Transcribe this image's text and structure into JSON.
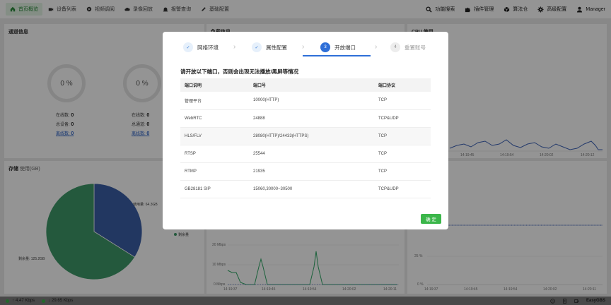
{
  "nav": [
    {
      "label": "首页概览",
      "icon": "home-icon",
      "active": true
    },
    {
      "label": "设备列表",
      "icon": "video-camera-icon"
    },
    {
      "label": "视频调阅",
      "icon": "play-circle-icon"
    },
    {
      "label": "录像回放",
      "icon": "cloud-icon"
    },
    {
      "label": "报警查询",
      "icon": "alarm-icon"
    },
    {
      "label": "基础配置",
      "icon": "pencil-icon"
    }
  ],
  "tools": [
    {
      "label": "功能搜索",
      "icon": "search-icon"
    },
    {
      "label": "插件管理",
      "icon": "puzzle-icon"
    },
    {
      "label": "算法仓",
      "icon": "cube-icon"
    },
    {
      "label": "高级配置",
      "icon": "gear-icon"
    },
    {
      "label": "Manager",
      "icon": "user-icon"
    }
  ],
  "panels": {
    "channel": {
      "title": "通道信息",
      "gauges": [
        {
          "value": "0 %",
          "online_label": "在线数:",
          "online": "0",
          "total_label": "总设备:",
          "total": "0",
          "offline_label": "离线数:",
          "offline": "0"
        },
        {
          "value": "0 %",
          "online_label": "在线数:",
          "online": "0",
          "total_label": "总通道:",
          "total": "0",
          "offline_label": "离线数:",
          "offline": "0"
        }
      ]
    },
    "load": {
      "title": "负载信息"
    },
    "cpu": {
      "title": "CPU 使用",
      "x_ticks": [
        "14:19:45",
        "14:19:54",
        "14:20:02",
        "14:20:12"
      ]
    },
    "storage": {
      "title": "存储",
      "title_sub": "使用(GB)",
      "used_label": "使用量: 64.3GB",
      "free_label": "剩余量: 125.2GB",
      "legend_free": "剩余量"
    },
    "network": {
      "y_ticks": [
        "20 Mbps",
        "10 Mbps",
        "0 Mbps"
      ],
      "x_ticks": [
        "14:19:37",
        "14:19:45",
        "14:19:54",
        "14:20:02",
        "14:20:11"
      ]
    },
    "memory": {
      "y_ticks": [
        "25 %",
        "0 %"
      ],
      "x_ticks": [
        "14:19:37",
        "14:19:45",
        "14:19:54",
        "14:20:02",
        "14:20:11"
      ]
    }
  },
  "modal": {
    "steps": [
      {
        "num": "✓",
        "label": "网络环境",
        "state": "done"
      },
      {
        "num": "✓",
        "label": "属性配置",
        "state": "done"
      },
      {
        "num": "3",
        "label": "开放端口",
        "state": "current"
      },
      {
        "num": "4",
        "label": "重置账号",
        "state": "todo"
      }
    ],
    "instruction": "请开放以下端口，否则会出现无法播放/黑屏等情况",
    "columns": [
      "端口说明",
      "端口号",
      "端口协议"
    ],
    "rows": [
      [
        "管理平台",
        "10000(HTTP)",
        "TCP"
      ],
      [
        "WebRTC",
        "24888",
        "TCP&UDP"
      ],
      [
        "HLS/FLV",
        "28080(HTTP)/24433(HTTPS)",
        "TCP"
      ],
      [
        "RTSP",
        "25544",
        "TCP"
      ],
      [
        "RTMP",
        "21935",
        "TCP"
      ],
      [
        "GB28181 SIP",
        "15060,30000~30500",
        "TCP&UDP"
      ]
    ],
    "confirm_label": "确 定"
  },
  "status": {
    "up": "4.47 Kbps",
    "down": "29.65 Kbps",
    "brand": "EasyGBS"
  },
  "colors": {
    "accent_green": "#3bb64a",
    "step_blue": "#2e6fd8",
    "pie_used": "#3b5fa8",
    "pie_free": "#3f9a6a",
    "line_blue": "#3d63b8",
    "net_green": "#2fa866"
  }
}
